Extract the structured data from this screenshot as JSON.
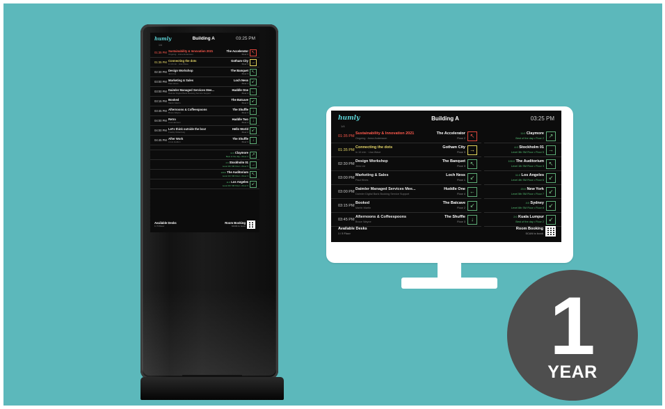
{
  "colors": {
    "background": "#5cb8bb",
    "badge": "#4e4e4e",
    "accent": "#5cd3d6",
    "busy": "#ff5a4d",
    "upcoming": "#e8d96a",
    "free": "#7ed08f"
  },
  "signage": {
    "logo": "humly",
    "building": "Building A",
    "time": "03:25 PM",
    "page": "1/4"
  },
  "kiosk_events": [
    {
      "time": "01:35 PM",
      "title": "Sustainability & Innovation 2021",
      "sub": "Ongoing · Anna Andersson",
      "room": "The Accelerator",
      "floor": "Floor 2",
      "icon": "arrow-up-left-icon",
      "glyph": "↖",
      "state": "now"
    },
    {
      "time": "01:35 PM",
      "title": "Connecting the dots",
      "sub": "in 10 min · Lisa Wave",
      "room": "Gotham City",
      "floor": "Floor 3",
      "icon": "arrow-right-icon",
      "glyph": "→",
      "state": "next"
    },
    {
      "time": "02:30 PM",
      "title": "Design Workshop",
      "sub": "Jens Lie",
      "room": "The Banquet",
      "floor": "Floor 3",
      "icon": "arrow-up-left-icon",
      "glyph": "↖",
      "state": ""
    },
    {
      "time": "03:00 PM",
      "title": "Marketing & Sales",
      "sub": "Paul Hines",
      "room": "Loch Ness",
      "floor": "Floor 1",
      "icon": "arrow-down-left-icon",
      "glyph": "↙",
      "state": ""
    },
    {
      "time": "03:00 PM",
      "title": "Daimler Managed Services Mee...",
      "sub": "Daimler Digital Bank Booking Service Support",
      "room": "Huddle One",
      "floor": "Floor 4",
      "icon": "arrow-left-icon",
      "glyph": "←",
      "state": ""
    },
    {
      "time": "03:15 PM",
      "title": "Booked",
      "sub": "Martin Martin",
      "room": "The Batcave",
      "floor": "Floor 2",
      "icon": "arrow-down-left-icon",
      "glyph": "↙",
      "state": ""
    },
    {
      "time": "03:45 PM",
      "title": "Afternoons & Coffeespoons",
      "sub": "Bruce Wayne",
      "room": "The Shuffle",
      "floor": "Floor 3",
      "icon": "arrow-down-icon",
      "glyph": "↓",
      "state": ""
    },
    {
      "time": "04:00 PM",
      "title": "Retro",
      "sub": "Lisa Harrison",
      "room": "Huddle Two",
      "floor": "Floor 4",
      "icon": "arrow-down-icon",
      "glyph": "↓",
      "state": ""
    },
    {
      "time": "04:00 PM",
      "title": "Let's think outside the box!",
      "sub": "Freddy Oldenburg",
      "room": "Hello World",
      "floor": "Floor 2",
      "icon": "arrow-down-left-icon",
      "glyph": "↙",
      "state": ""
    },
    {
      "time": "04:45 PM",
      "title": "After Work",
      "sub": "Linus Holden",
      "room": "The Shuffle",
      "floor": "Floor 3",
      "icon": "arrow-down-icon",
      "glyph": "↓",
      "state": ""
    }
  ],
  "monitor_events": [
    {
      "time": "01:35 PM",
      "title": "Sustainability & Innovation 2021",
      "sub": "Ongoing · Anna Andersson",
      "room": "The Accelerator",
      "floor": "Floor 2",
      "icon": "arrow-up-left-icon",
      "glyph": "↖",
      "state": "now"
    },
    {
      "time": "01:35 PM",
      "title": "Connecting the dots",
      "sub": "in 10 min · Lisa Wave",
      "room": "Gotham City",
      "floor": "Floor 3",
      "icon": "arrow-right-icon",
      "glyph": "→",
      "state": "next"
    },
    {
      "time": "02:30 PM",
      "title": "Design Workshop",
      "sub": "Jens Lie",
      "room": "The Banquet",
      "floor": "Floor 3",
      "icon": "arrow-up-left-icon",
      "glyph": "↖",
      "state": ""
    },
    {
      "time": "03:00 PM",
      "title": "Marketing & Sales",
      "sub": "Paul Hines",
      "room": "Loch Ness",
      "floor": "Floor 1",
      "icon": "arrow-down-left-icon",
      "glyph": "↙",
      "state": ""
    },
    {
      "time": "03:00 PM",
      "title": "Daimler Managed Services Mee...",
      "sub": "Daimler Digital Bank Booking Service Support",
      "room": "Huddle One",
      "floor": "Floor 4",
      "icon": "arrow-left-icon",
      "glyph": "←",
      "state": ""
    },
    {
      "time": "03:15 PM",
      "title": "Booked",
      "sub": "Martin Martin",
      "room": "The Batcave",
      "floor": "Floor 2",
      "icon": "arrow-down-left-icon",
      "glyph": "↙",
      "state": ""
    },
    {
      "time": "03:45 PM",
      "title": "Afternoons & Coffeespoons",
      "sub": "Bruce Wayne",
      "room": "The Shuffle",
      "floor": "Floor 3",
      "icon": "arrow-down-icon",
      "glyph": "↓",
      "state": ""
    }
  ],
  "directions": [
    {
      "dist": "11:0",
      "name": "Claymore",
      "sub": "Best of the day • Floor 2",
      "icon": "arrow-up-right-icon",
      "glyph": "↗"
    },
    {
      "dist": "4:0",
      "name": "Stockholm 01",
      "sub": "Level 3th SM Floor • Floor 5",
      "icon": "arrow-right-icon",
      "glyph": "→"
    },
    {
      "dist": "100:0",
      "name": "The Auditorium",
      "sub": "Level 1th SM Floor • Floor 3",
      "icon": "arrow-up-left-icon",
      "glyph": "↖"
    },
    {
      "dist": "11:0",
      "name": "Los Angeles",
      "sub": "Level 4th SM Floor • Floor 6",
      "icon": "arrow-down-left-icon",
      "glyph": "↙"
    },
    {
      "dist": "20:0",
      "name": "New York",
      "sub": "Level 5th SM Floor • Floor 7",
      "icon": "arrow-down-left-icon",
      "glyph": "↙"
    },
    {
      "dist": "4:0",
      "name": "Sydney",
      "sub": "Level 6th SM Floor • Floor 8",
      "icon": "arrow-down-left-icon",
      "glyph": "↙"
    },
    {
      "dist": "2:0",
      "name": "Kuala Lumpur",
      "sub": "Best of the day • Floor 2",
      "icon": "arrow-down-left-icon",
      "glyph": "↙"
    }
  ],
  "footer": {
    "left_label": "Available Desks",
    "left_sub": "1 / 5 Floor",
    "right_label": "Room Booking",
    "right_sub": "SCAN to book"
  },
  "badge": {
    "number": "1",
    "word": "YEAR"
  }
}
